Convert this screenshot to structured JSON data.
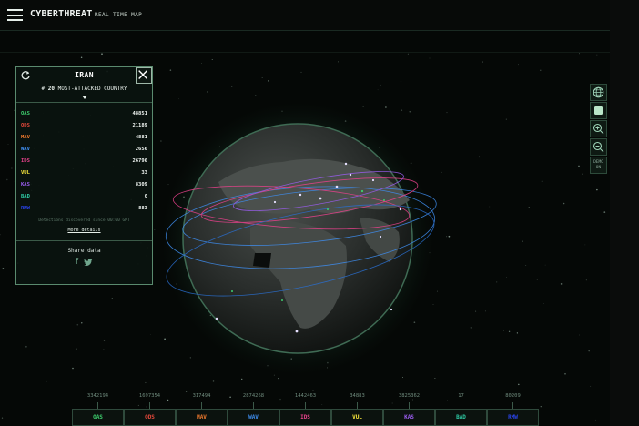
{
  "header": {
    "brand": "CYBERTHREAT",
    "brand_sub": "REAL-TIME MAP"
  },
  "panel": {
    "country": "IRAN",
    "rank_prefix": "# ",
    "rank_number": "20",
    "rank_text": " MOST-ATTACKED COUNTRY",
    "stats": [
      {
        "code": "OAS",
        "value": "48851",
        "color": "#3ecf6e"
      },
      {
        "code": "ODS",
        "value": "21189",
        "color": "#e5483b"
      },
      {
        "code": "MAV",
        "value": "4881",
        "color": "#f07a2e"
      },
      {
        "code": "WAV",
        "value": "2656",
        "color": "#3f8ef0"
      },
      {
        "code": "IDS",
        "value": "26796",
        "color": "#e8428c"
      },
      {
        "code": "VUL",
        "value": "33",
        "color": "#f3e33b"
      },
      {
        "code": "KAS",
        "value": "8309",
        "color": "#9b5df0"
      },
      {
        "code": "BAD",
        "value": "0",
        "color": "#2ec9a3"
      },
      {
        "code": "RMW",
        "value": "883",
        "color": "#2a43e8"
      }
    ],
    "since_text": "Detections discovered since 00:00 GMT",
    "more_details": "More details",
    "share_title": "Share data",
    "share_icons": [
      "facebook-icon",
      "twitter-icon"
    ]
  },
  "tools": {
    "demo_line1": "DEMO",
    "demo_line2": "ON"
  },
  "legend": [
    {
      "count": "3342194",
      "code": "OAS",
      "color": "#3ecf6e"
    },
    {
      "count": "1697354",
      "code": "ODS",
      "color": "#e5483b"
    },
    {
      "count": "317494",
      "code": "MAV",
      "color": "#f07a2e"
    },
    {
      "count": "2874268",
      "code": "WAV",
      "color": "#3f8ef0"
    },
    {
      "count": "1442463",
      "code": "IDS",
      "color": "#e8428c"
    },
    {
      "count": "34883",
      "code": "VUL",
      "color": "#f3e33b"
    },
    {
      "count": "3825362",
      "code": "KAS",
      "color": "#9b5df0"
    },
    {
      "count": "17",
      "code": "BAD",
      "color": "#2ec9a3"
    },
    {
      "count": "80209",
      "code": "RMW",
      "color": "#2a43e8"
    }
  ]
}
